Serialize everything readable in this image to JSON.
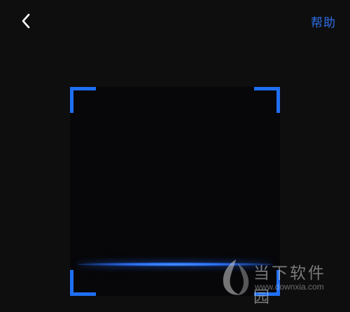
{
  "header": {
    "help_label": "帮助"
  },
  "icons": {
    "back": "chevron-left-icon"
  },
  "colors": {
    "background": "#0e0e0f",
    "accent": "#1f6ff2",
    "help_text": "#2f6fe6"
  },
  "watermark": {
    "title": "当下软件园",
    "url": "www.downxia.com"
  }
}
